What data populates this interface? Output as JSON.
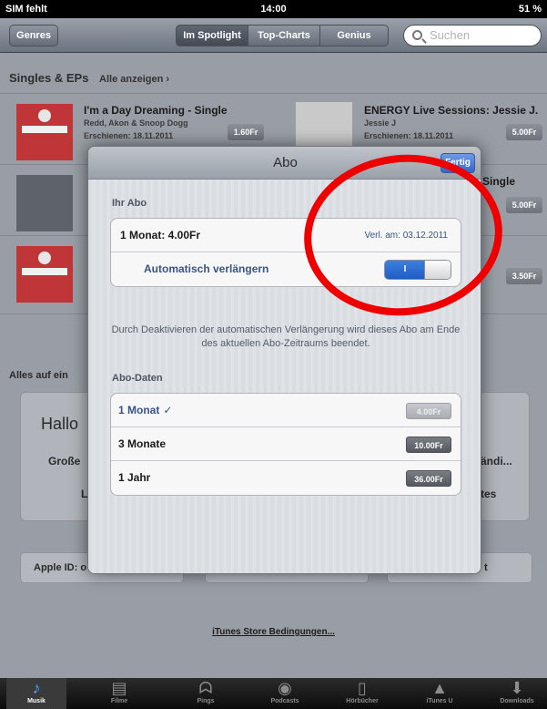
{
  "status_bar": {
    "carrier": "SIM fehlt",
    "time": "14:00",
    "battery": "51 %"
  },
  "nav": {
    "genres": "Genres",
    "segments": [
      "Im Spotlight",
      "Top-Charts",
      "Genius"
    ],
    "search_placeholder": "Suchen"
  },
  "background": {
    "section_title": "Singles & EPs",
    "see_all": "Alle anzeigen ›",
    "items": [
      {
        "title": "I'm a Day Dreaming - Single",
        "artist": "Redd, Akon & Snoop Dogg",
        "released": "Erschienen: 18.11.2011",
        "price": "1.60Fr"
      },
      {
        "title": "ENERGY Live Sessions: Jessie J.",
        "artist": "Jessie J",
        "released": "Erschienen: 18.11.2011",
        "price": "5.00Fr"
      },
      {
        "title": "Single",
        "price": "5.00Fr"
      },
      {
        "price": "3.50Fr"
      }
    ],
    "all_on": "Alles auf ein",
    "hallo": "Hallo",
    "grosse": "Große",
    "andi": "ändi...",
    "tes": "tes",
    "l": "L",
    "apple_id": "Apple ID: o",
    "t": "t",
    "terms": "iTunes Store Bedingungen..."
  },
  "modal": {
    "title": "Abo",
    "done": "Fertig",
    "your_sub_label": "Ihr Abo",
    "plan_line": "1 Monat: 4.00Fr",
    "renew_date": "Verl. am: 03.12.2011",
    "auto_renew_label": "Automatisch verlängern",
    "toggle_state": "I",
    "footnote": "Durch Deaktivieren der automatischen Verlängerung wird dieses Abo am Ende des aktuellen Abo-Zeitraums beendet.",
    "data_label": "Abo-Daten",
    "plans": [
      {
        "name": "1 Monat",
        "price": "4.00Fr",
        "selected": true,
        "check": "✓"
      },
      {
        "name": "3 Monate",
        "price": "10.00Fr",
        "selected": false
      },
      {
        "name": "1 Jahr",
        "price": "36.00Fr",
        "selected": false
      }
    ]
  },
  "tabs": [
    {
      "label": "Musik",
      "icon": "music-note-icon",
      "glyph": "♪",
      "active": true
    },
    {
      "label": "Filme",
      "icon": "film-icon",
      "glyph": "▤",
      "active": false
    },
    {
      "label": "Pings",
      "icon": "ping-icon",
      "glyph": "ᗣ",
      "active": false
    },
    {
      "label": "Podcasts",
      "icon": "podcast-icon",
      "glyph": "◉",
      "active": false
    },
    {
      "label": "Hörbücher",
      "icon": "audiobook-icon",
      "glyph": "▯",
      "active": false
    },
    {
      "label": "iTunes U",
      "icon": "mortarboard-icon",
      "glyph": "▲",
      "active": false
    },
    {
      "label": "Downloads",
      "icon": "download-icon",
      "glyph": "⬇",
      "active": false
    }
  ],
  "annotation_color": "#ee0000"
}
